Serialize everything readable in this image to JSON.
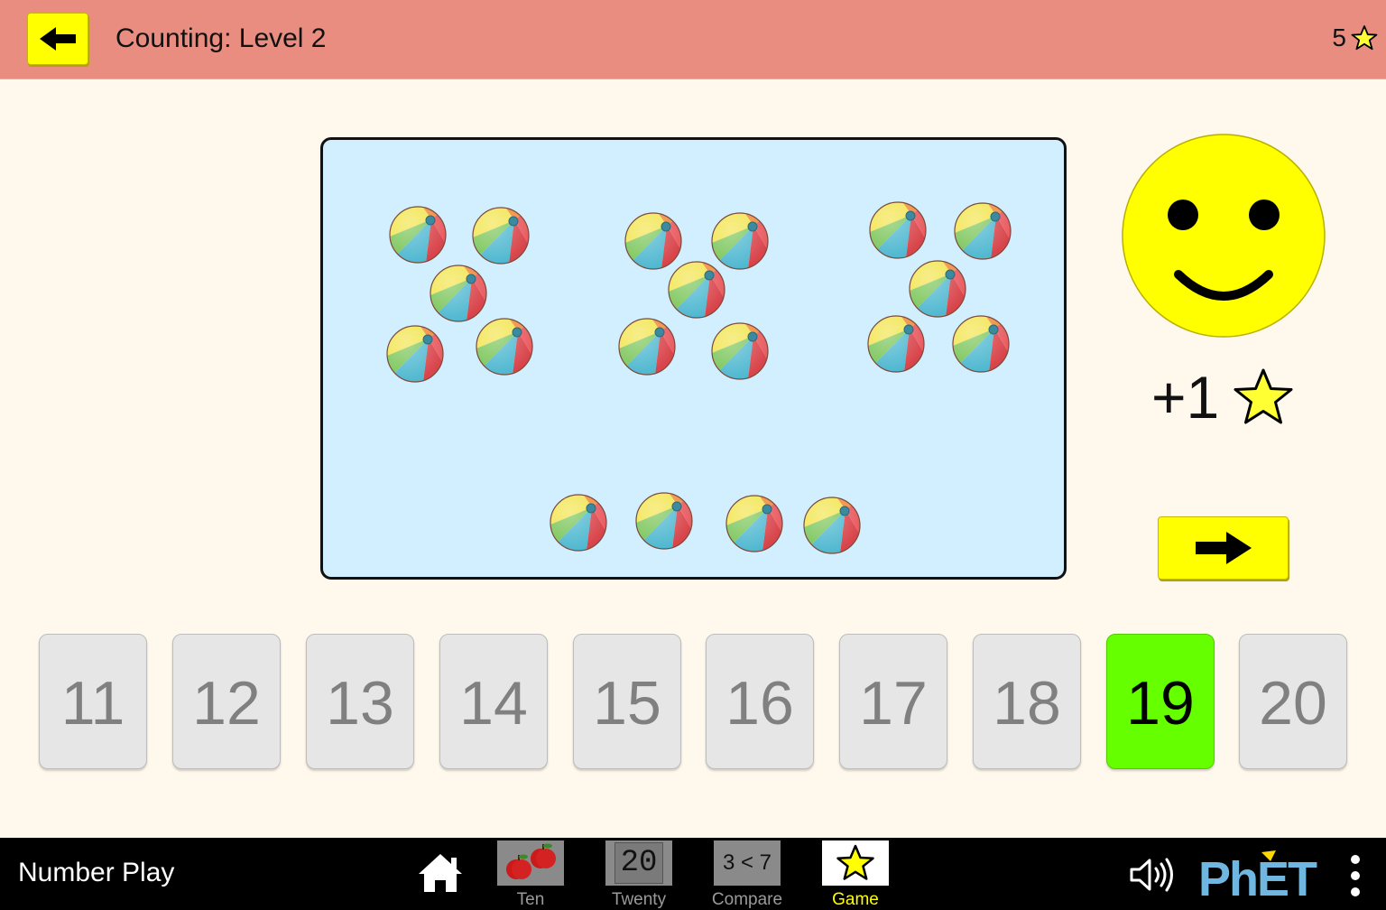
{
  "header": {
    "title": "Counting: Level 2",
    "score": "5"
  },
  "challenge": {
    "object_icon": "beach-ball-icon",
    "object_count": 19
  },
  "feedback": {
    "reward_text": "+1"
  },
  "answers": {
    "buttons": [
      "11",
      "12",
      "13",
      "14",
      "15",
      "16",
      "17",
      "18",
      "19",
      "20"
    ],
    "selected": "19"
  },
  "navbar": {
    "sim_title": "Number Play",
    "screens": [
      {
        "label": "Ten",
        "icon": "apples-icon",
        "active": false
      },
      {
        "label": "Twenty",
        "icon": "twenty-icon",
        "active": false,
        "icon_text": "20"
      },
      {
        "label": "Compare",
        "icon": "compare-icon",
        "active": false,
        "icon_text": "3 < 7"
      },
      {
        "label": "Game",
        "icon": "star-icon",
        "active": true
      }
    ],
    "logo_text": "PhET"
  },
  "colors": {
    "header_bg": "#e88d7f",
    "page_bg": "#fff8ec",
    "play_area_bg": "#d2efff",
    "button_yellow": "#ffff00",
    "selected_green": "#66ff00",
    "smiley_yellow": "#ffff00"
  }
}
